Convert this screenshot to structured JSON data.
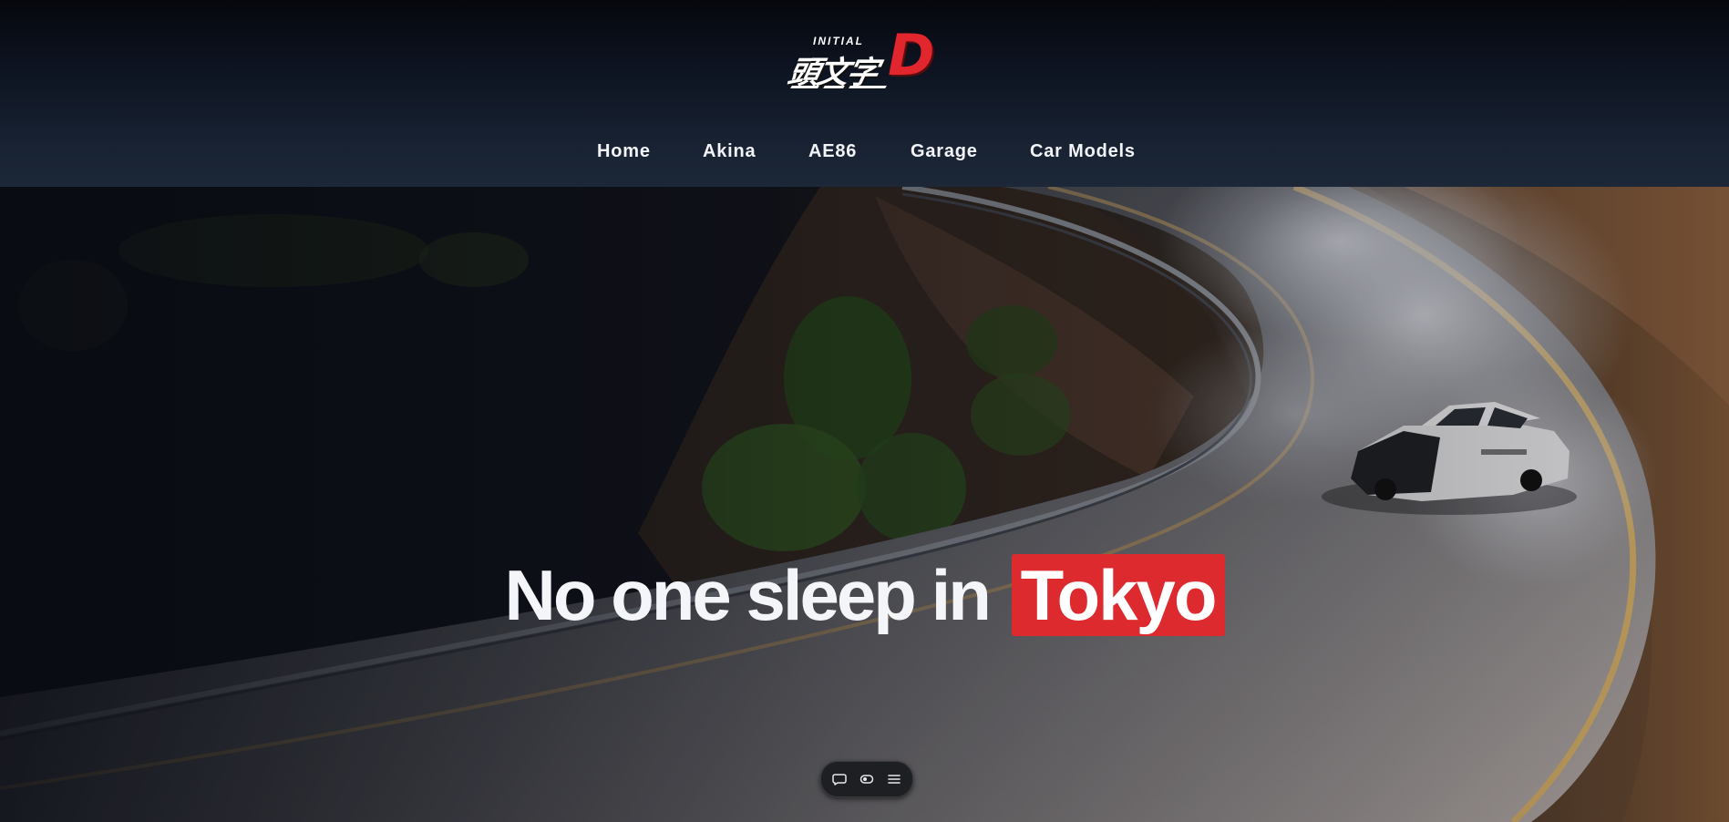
{
  "header": {
    "logo": {
      "superscript": "INITIAL",
      "kanji": "頭文字",
      "letter": "D"
    },
    "nav": [
      {
        "label": "Home"
      },
      {
        "label": "Akina"
      },
      {
        "label": "AE86"
      },
      {
        "label": "Garage"
      },
      {
        "label": "Car Models"
      }
    ]
  },
  "hero": {
    "headline_plain": "No one sleep in",
    "headline_highlight": "Tokyo",
    "image_icon": "drifting-car-mountain-road-photo"
  },
  "toolbar_pill": {
    "icons": [
      "comment-icon",
      "toggle-icon",
      "menu-icon"
    ]
  },
  "colors": {
    "accent_red": "#dc2a2e",
    "header_dark": "#05070c",
    "header_light": "#1c2737",
    "nav_text": "#f2f4f8"
  }
}
